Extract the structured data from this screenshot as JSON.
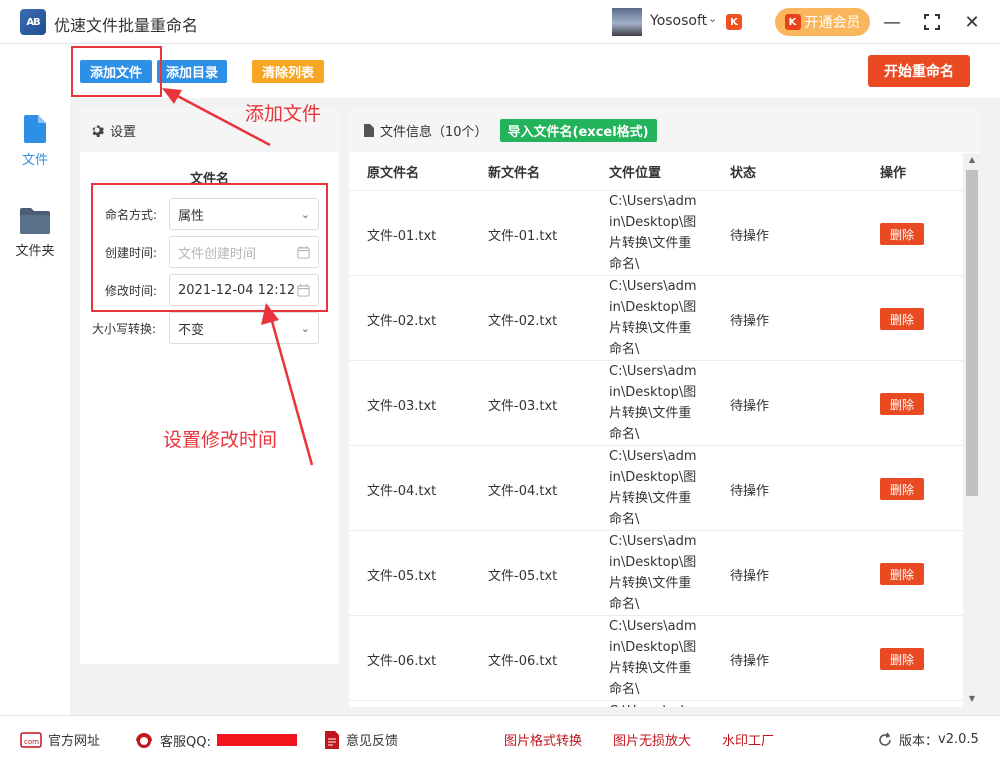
{
  "app": {
    "title": "优速文件批量重命名",
    "logo_text": "AB",
    "colors": {
      "primary": "#2e8fe6",
      "accent": "#e94a22",
      "success": "#22b35b",
      "warning": "#f39c12"
    }
  },
  "user": {
    "name": "Yososoft",
    "vip_label": "开通会员"
  },
  "nav": [
    {
      "label": "文件",
      "icon": "file-icon",
      "active": true
    },
    {
      "label": "文件夹",
      "icon": "folder-icon",
      "active": false
    }
  ],
  "toolbar": {
    "add_file": "添加文件",
    "add_dir": "添加目录",
    "clear_list": "清除列表",
    "start": "开始重命名"
  },
  "settings": {
    "title": "设置",
    "section": "文件名",
    "fields": [
      {
        "label": "命名方式:",
        "value": "属性",
        "placeholder": ""
      },
      {
        "label": "创建时间:",
        "value": "",
        "placeholder": "文件创建时间"
      },
      {
        "label": "修改时间:",
        "value": "2021-12-04 12:12",
        "placeholder": ""
      },
      {
        "label": "大小写转换:",
        "value": "不变",
        "placeholder": ""
      }
    ]
  },
  "files": {
    "title": "文件信息（10个）",
    "import_label": "导入文件名(excel格式)",
    "columns": [
      "原文件名",
      "新文件名",
      "文件位置",
      "状态",
      "操作"
    ],
    "rows": [
      {
        "orig": "文件-01.txt",
        "new": "文件-01.txt",
        "loc": "C:\\Users\\admin\\Desktop\\图片转换\\文件重命名\\",
        "status": "待操作",
        "action": "删除"
      },
      {
        "orig": "文件-02.txt",
        "new": "文件-02.txt",
        "loc": "C:\\Users\\admin\\Desktop\\图片转换\\文件重命名\\",
        "status": "待操作",
        "action": "删除"
      },
      {
        "orig": "文件-03.txt",
        "new": "文件-03.txt",
        "loc": "C:\\Users\\admin\\Desktop\\图片转换\\文件重命名\\",
        "status": "待操作",
        "action": "删除"
      },
      {
        "orig": "文件-04.txt",
        "new": "文件-04.txt",
        "loc": "C:\\Users\\admin\\Desktop\\图片转换\\文件重命名\\",
        "status": "待操作",
        "action": "删除"
      },
      {
        "orig": "文件-05.txt",
        "new": "文件-05.txt",
        "loc": "C:\\Users\\admin\\Desktop\\图片转换\\文件重命名\\",
        "status": "待操作",
        "action": "删除"
      },
      {
        "orig": "文件-06.txt",
        "new": "文件-06.txt",
        "loc": "C:\\Users\\admin\\Desktop\\图片转换\\文件重命名\\",
        "status": "待操作",
        "action": "删除"
      },
      {
        "orig": "",
        "new": "",
        "loc": "C:\\Users\\ad",
        "status": "",
        "action": ""
      }
    ]
  },
  "footer": {
    "website": "官方网址",
    "qq": "客服QQ:",
    "feedback": "意见反馈",
    "links": [
      "图片格式转换",
      "图片无损放大",
      "水印工厂"
    ],
    "version_label": "版本：",
    "version": "v2.0.5"
  },
  "annotations": {
    "add_file": "添加文件",
    "set_time": "设置修改时间"
  }
}
